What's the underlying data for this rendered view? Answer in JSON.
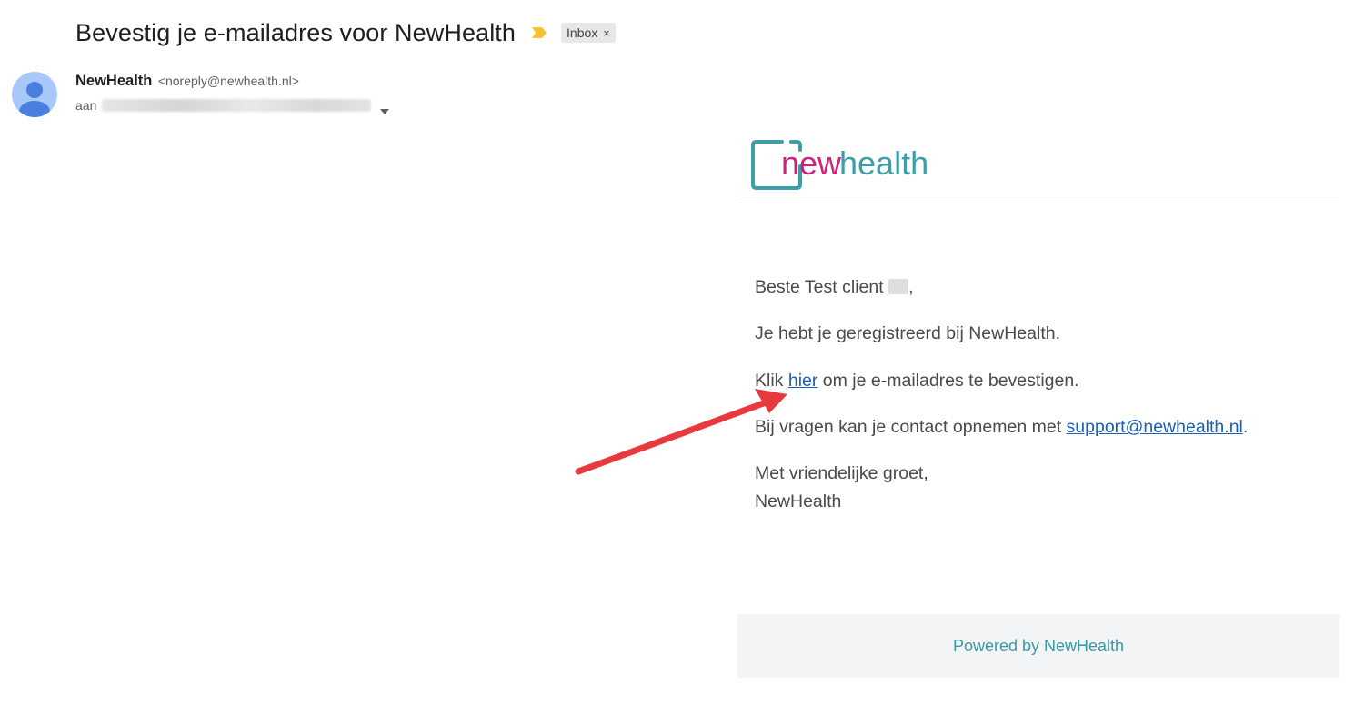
{
  "email": {
    "subject": "Bevestig je e-mailadres voor NewHealth",
    "label": "Inbox",
    "label_remove": "×",
    "sender_name": "NewHealth",
    "sender_email": "<noreply@newhealth.nl>",
    "to_prefix": "aan"
  },
  "logo": {
    "word_part1": "new",
    "word_part2": "health",
    "color_new": "#c8277d",
    "color_health": "#3c9ea8"
  },
  "body": {
    "greeting": "Beste Test client",
    "greeting_end": ",",
    "line_registered": "Je hebt je geregistreerd bij NewHealth.",
    "click_prefix": "Klik ",
    "click_link": "hier",
    "click_suffix": " om je e-mailadres te bevestigen.",
    "questions_prefix": "Bij vragen kan je contact opnemen met ",
    "support_link": "support@newhealth.nl",
    "questions_suffix": ".",
    "closing": "Met vriendelijke groet,",
    "signature": "NewHealth"
  },
  "footer": {
    "powered_by": "Powered by NewHealth"
  },
  "colors": {
    "link": "#1a5fb4",
    "footer_text": "#3a99a5",
    "annotation_arrow": "#e8393f",
    "avatar_bg": "#a8c7fa",
    "avatar_fg": "#4a7fe0"
  },
  "icons": {
    "importance": "importance-marker-icon",
    "avatar": "person-avatar-icon",
    "caret": "caret-down-icon",
    "annotation": "red-arrow-annotation"
  }
}
